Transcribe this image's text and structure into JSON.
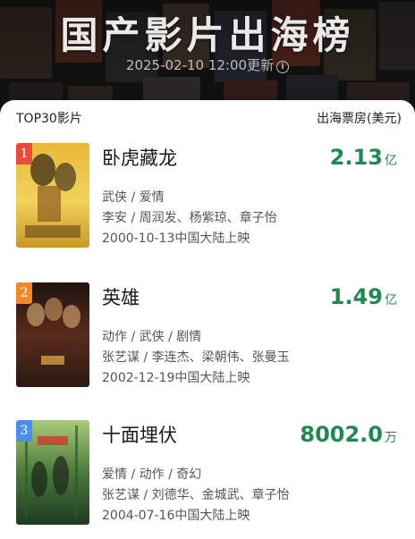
{
  "banner": {
    "title": "国产影片出海榜",
    "update_time": "2025-02-10 12:00更新",
    "info_icon": "info-icon"
  },
  "list_header": {
    "left": "TOP30影片",
    "right": "出海票房(美元)"
  },
  "movies": [
    {
      "rank": "1",
      "title": "卧虎藏龙",
      "box_value": "2.13",
      "box_unit": "亿",
      "genre": "武侠 / 爱情",
      "crew": "李安 / 周润发、杨紫琼、章子怡",
      "release": "2000-10-13中国大陆上映",
      "poster_colors": [
        "#c99a2e",
        "#f0c94a",
        "#7a4d12"
      ]
    },
    {
      "rank": "2",
      "title": "英雄",
      "box_value": "1.49",
      "box_unit": "亿",
      "genre": "动作 / 武侠 / 剧情",
      "crew": "张艺谋 / 李连杰、梁朝伟、张曼玉",
      "release": "2002-12-19中国大陆上映",
      "poster_colors": [
        "#2a1a14",
        "#7a3a24",
        "#c9a06a"
      ]
    },
    {
      "rank": "3",
      "title": "十面埋伏",
      "box_value": "8002.0",
      "box_unit": "万",
      "genre": "爱情 / 动作 / 奇幻",
      "crew": "张艺谋 / 刘德华、金城武、章子怡",
      "release": "2004-07-16中国大陆上映",
      "poster_colors": [
        "#1f3a24",
        "#4f7a3a",
        "#9cc26a"
      ]
    }
  ],
  "colors": {
    "box_green": "#1f8a4f",
    "rank_1": "#e84b3c",
    "rank_2": "#ef8a24",
    "rank_3": "#4a8ff0"
  }
}
